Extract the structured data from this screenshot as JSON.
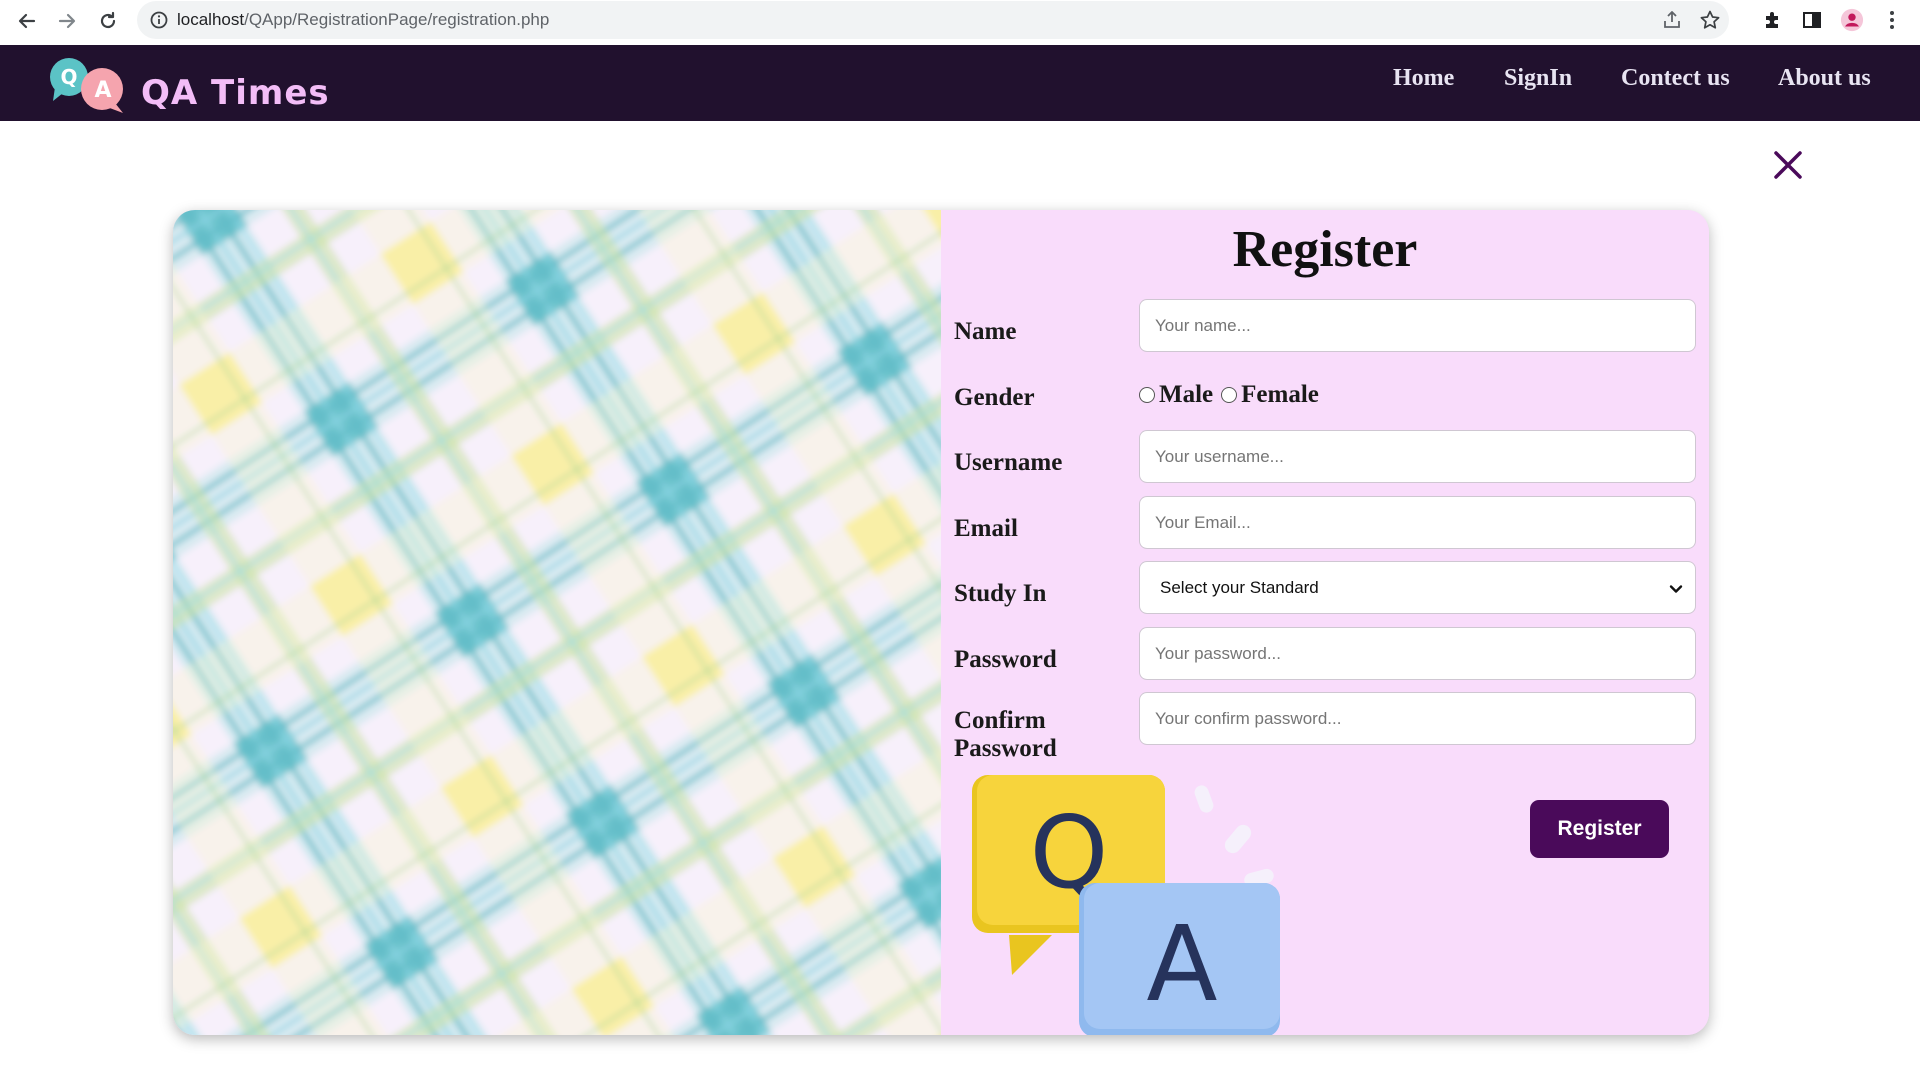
{
  "browser": {
    "url_host": "localhost",
    "url_path": "/QApp/RegistrationPage/registration.php"
  },
  "header": {
    "site_title": "QA Times",
    "logo_letters": [
      "Q",
      "A"
    ],
    "nav": [
      {
        "label": "Home"
      },
      {
        "label": "SignIn"
      },
      {
        "label": "Contect us"
      },
      {
        "label": "About us"
      }
    ]
  },
  "form": {
    "title": "Register",
    "name": {
      "label": "Name",
      "placeholder": "Your name..."
    },
    "gender": {
      "label": "Gender",
      "options": [
        "Male",
        "Female"
      ]
    },
    "username": {
      "label": "Username",
      "placeholder": "Your username..."
    },
    "email": {
      "label": "Email",
      "placeholder": "Your Email..."
    },
    "study": {
      "label": "Study In",
      "selected": "Select your Standard"
    },
    "password": {
      "label": "Password",
      "placeholder": "Your password..."
    },
    "confirm": {
      "label_line1": "Confirm",
      "label_line2": "Password",
      "placeholder": "Your confirm password..."
    },
    "submit_label": "Register"
  },
  "illustration": {
    "letters": [
      "Q",
      "A"
    ]
  },
  "colors": {
    "header_bg": "#21112e",
    "title_color": "#f3bdf7",
    "form_bg": "#f9dcfb",
    "button_bg": "#4a0a5a",
    "close_color": "#4a0a5a"
  },
  "icons": [
    "back-arrow-icon",
    "forward-arrow-icon",
    "reload-icon",
    "site-info-icon",
    "share-icon",
    "bookmark-star-icon",
    "extensions-puzzle-icon",
    "side-panel-icon",
    "profile-icon",
    "kebab-menu-icon",
    "close-icon",
    "chevron-down-icon"
  ]
}
